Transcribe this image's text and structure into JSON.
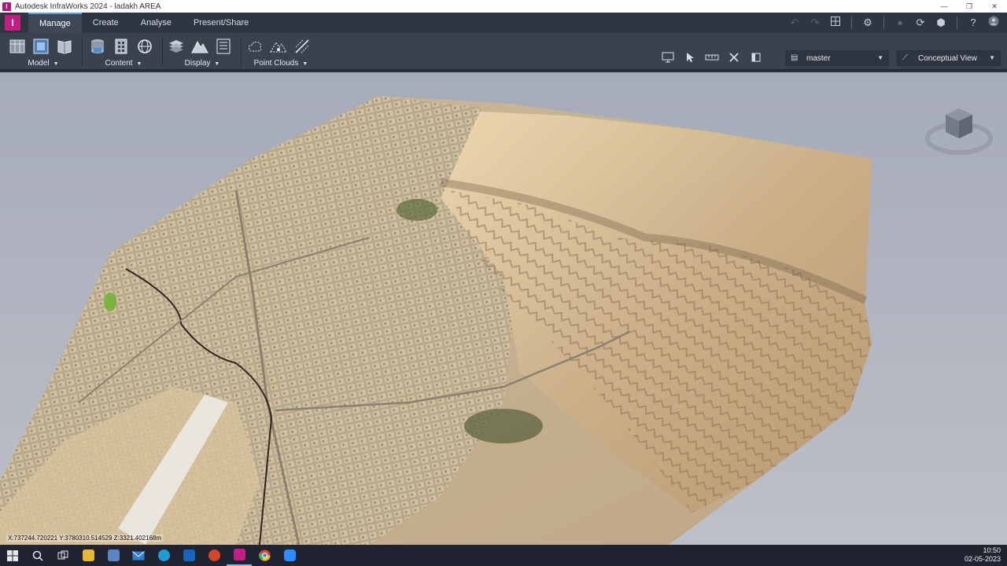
{
  "window": {
    "title": "Autodesk InfraWorks 2024 - ladakh AREA",
    "app_logo_letter": "I",
    "controls": {
      "minimize": "—",
      "restore": "❐",
      "close": "✕"
    }
  },
  "tabs": [
    {
      "label": "Manage",
      "active": true
    },
    {
      "label": "Create",
      "active": false
    },
    {
      "label": "Analyse",
      "active": false
    },
    {
      "label": "Present/Share",
      "active": false
    }
  ],
  "ribbon": {
    "groups": [
      {
        "label": "Model",
        "icons": [
          "model-table-icon",
          "model-explorer-icon",
          "model-book-icon"
        ]
      },
      {
        "label": "Content",
        "icons": [
          "data-sources-icon",
          "building-grid-icon",
          "globe-icon"
        ]
      },
      {
        "label": "Display",
        "icons": [
          "layers-icon",
          "terrain-icon",
          "list-icon"
        ]
      },
      {
        "label": "Point Clouds",
        "icons": [
          "cloud-point-icon",
          "point-terrain-icon",
          "point-line-icon"
        ]
      }
    ],
    "proposal": "master",
    "visual_style": "Conceptual View"
  },
  "viewport": {
    "coords": "X:737244.720221 Y:3780310.514529 Z:3321.402168m"
  },
  "taskbar": {
    "time": "10:50",
    "date": "02-05-2023"
  },
  "colors": {
    "accent": "#5aa0e0",
    "brand": "#c41e83",
    "ribbon_bg": "#3a4250",
    "sky": "#b3b7c2"
  }
}
